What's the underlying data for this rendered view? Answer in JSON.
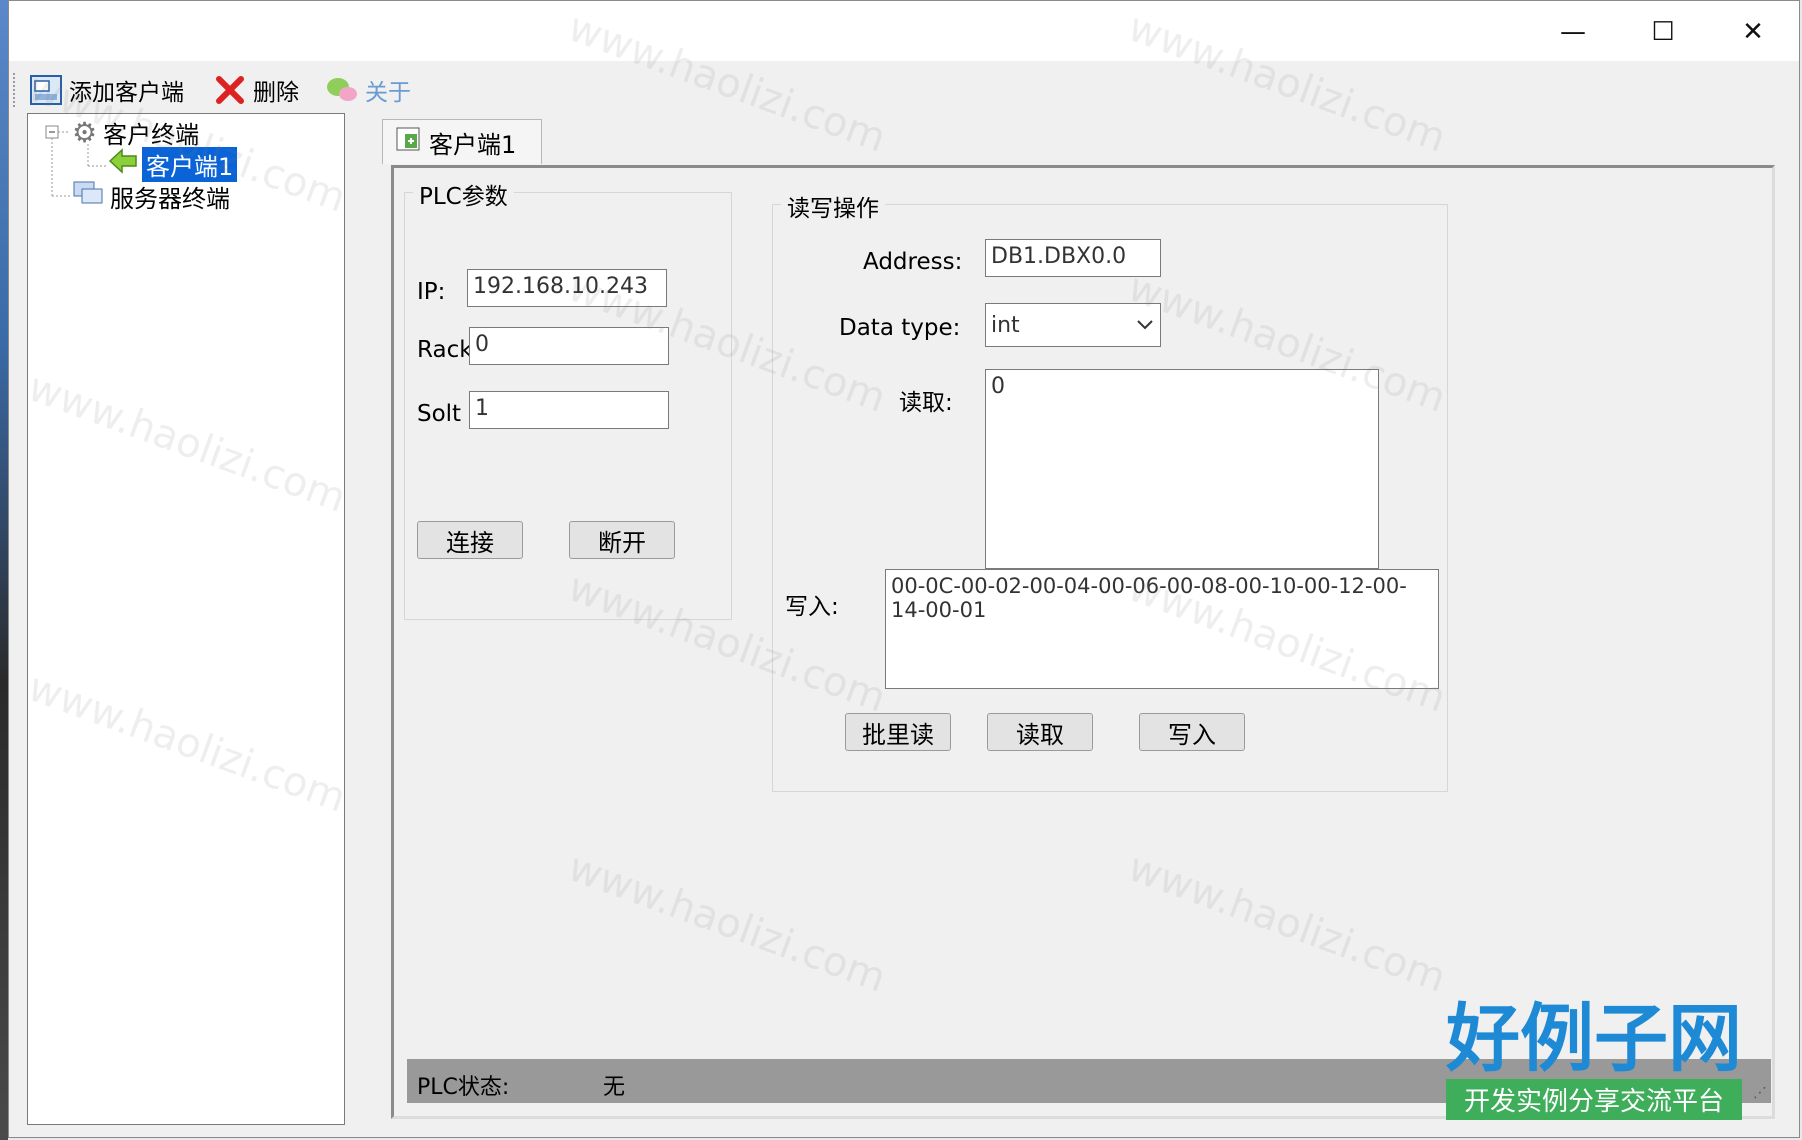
{
  "titlebar": {
    "minimize": "—",
    "maximize": "☐",
    "close": "✕"
  },
  "toolbar": {
    "add_client": "添加客户端",
    "delete": "删除",
    "about": "关于"
  },
  "tree": {
    "root": "客户终端",
    "selected_child": "客户端1",
    "server": "服务器终端"
  },
  "tab": {
    "label": "客户端1"
  },
  "plc": {
    "group_title": "PLC参数",
    "ip_label": "IP:",
    "ip_value": "192.168.10.243",
    "rack_label": "Rack",
    "rack_value": "0",
    "solt_label": "Solt",
    "solt_value": "1",
    "connect": "连接",
    "disconnect": "断开"
  },
  "rw": {
    "group_title": "读写操作",
    "address_label": "Address:",
    "address_value": "DB1.DBX0.0",
    "datatype_label": "Data type:",
    "datatype_value": "int",
    "read_label": "读取:",
    "read_value": "0",
    "write_label": "写入:",
    "write_value": "00-0C-00-02-00-04-00-06-00-08-00-10-00-12-00-14-00-01",
    "batch_read": "批里读",
    "read": "读取",
    "write": "写入"
  },
  "status": {
    "label": "PLC状态:",
    "value": "无"
  },
  "watermark": {
    "text": "www.haolizi.com",
    "brand": "好例子网",
    "brand_sub": "开发实例分享交流平台"
  },
  "colors": {
    "selection": "#0a64d8",
    "brand": "#1e8ad6",
    "status_bar": "#999999"
  }
}
